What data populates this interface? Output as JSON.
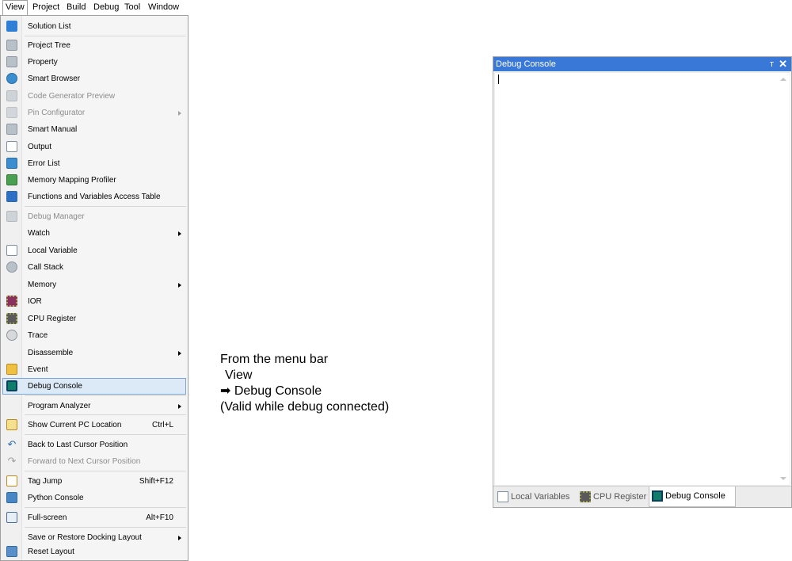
{
  "menubar": {
    "items": [
      "View",
      "Project",
      "Build",
      "Debug",
      "Tool",
      "Window"
    ]
  },
  "menu": {
    "items": [
      {
        "label": "Solution List",
        "icon": "solution-list-icon"
      },
      {
        "label": "Project Tree",
        "icon": "project-tree-icon"
      },
      {
        "label": "Property",
        "icon": "property-icon"
      },
      {
        "label": "Smart Browser",
        "icon": "smart-browser-icon"
      },
      {
        "label": "Code Generator Preview",
        "icon": "code-generator-preview-icon",
        "disabled": true
      },
      {
        "label": "Pin Configurator",
        "icon": "pin-configurator-icon",
        "disabled": true,
        "submenu": true
      },
      {
        "label": "Smart Manual",
        "icon": "smart-manual-icon"
      },
      {
        "label": "Output",
        "icon": "output-icon"
      },
      {
        "label": "Error List",
        "icon": "error-list-icon"
      },
      {
        "label": "Memory Mapping Profiler",
        "icon": "memory-mapping-profiler-icon"
      },
      {
        "label": "Functions and Variables Access Table",
        "icon": "functions-variables-table-icon"
      },
      {
        "label": "Debug Manager",
        "icon": "debug-manager-icon",
        "disabled": true
      },
      {
        "label": "Watch",
        "submenu": true
      },
      {
        "label": "Local Variable",
        "icon": "local-variable-icon"
      },
      {
        "label": "Call Stack",
        "icon": "call-stack-icon"
      },
      {
        "label": "Memory",
        "submenu": true
      },
      {
        "label": "IOR",
        "icon": "ior-icon"
      },
      {
        "label": "CPU Register",
        "icon": "cpu-register-icon"
      },
      {
        "label": "Trace",
        "icon": "trace-icon"
      },
      {
        "label": "Disassemble",
        "submenu": true
      },
      {
        "label": "Event",
        "icon": "event-icon"
      },
      {
        "label": "Debug Console",
        "icon": "debug-console-icon",
        "highlighted": true
      },
      {
        "label": "Program Analyzer",
        "submenu": true
      },
      {
        "label": "Show Current PC Location",
        "shortcut": "Ctrl+L",
        "icon": "show-pc-location-icon"
      },
      {
        "label": "Back to Last Cursor Position",
        "icon": "back-arrow-icon"
      },
      {
        "label": "Forward to Next Cursor Position",
        "icon": "forward-arrow-icon",
        "disabled": true
      },
      {
        "label": "Tag Jump",
        "shortcut": "Shift+F12",
        "icon": "tag-jump-icon"
      },
      {
        "label": "Python Console",
        "icon": "python-console-icon"
      },
      {
        "label": "Full-screen",
        "shortcut": "Alt+F10",
        "icon": "full-screen-icon"
      },
      {
        "label": "Save or Restore Docking Layout",
        "submenu": true
      },
      {
        "label": "Reset Layout",
        "icon": "reset-layout-icon"
      }
    ]
  },
  "caption": {
    "line1": "From the menu bar",
    "line2": "View",
    "line3": "➡ Debug Console",
    "line4": "(Valid while debug connected)"
  },
  "panel": {
    "title": "Debug Console",
    "pin": "ᴛ",
    "close": "✕",
    "tabs": [
      "Local Variables",
      "CPU Register",
      "Debug Console"
    ]
  },
  "colors": {
    "panel_title_bg": "#3a78d8",
    "menu_highlight_bg": "#dce9f7",
    "menu_highlight_border": "#7aa4d8"
  }
}
